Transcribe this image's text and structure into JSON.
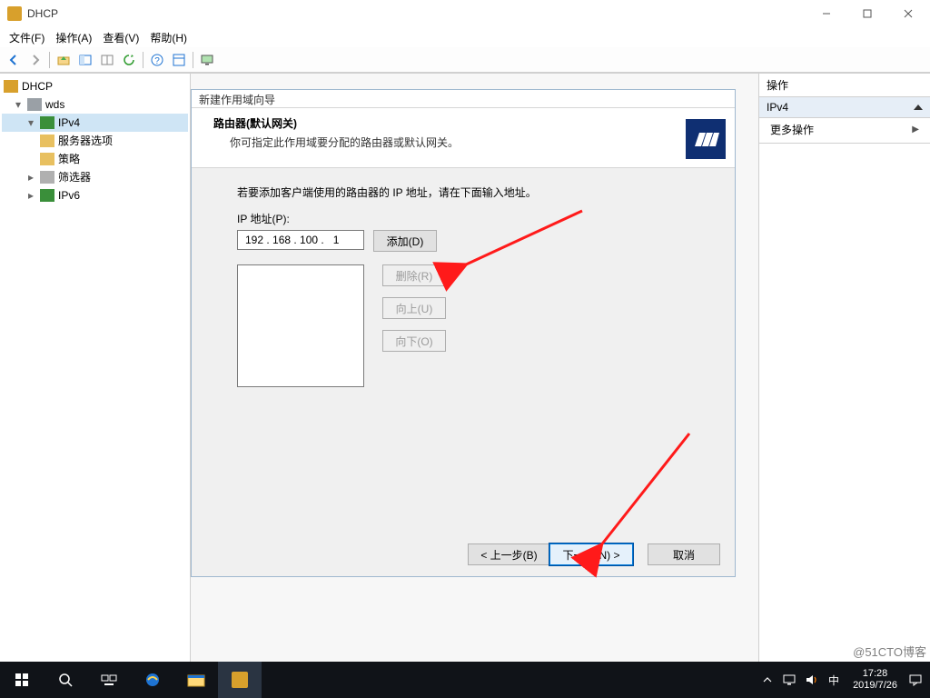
{
  "title": "DHCP",
  "menu": {
    "file": "文件(F)",
    "action": "操作(A)",
    "view": "查看(V)",
    "help": "帮助(H)"
  },
  "tree": {
    "root": "DHCP",
    "server": "wds",
    "ipv4": "IPv4",
    "server_options": "服务器选项",
    "policies": "策略",
    "filters": "筛选器",
    "ipv6": "IPv6"
  },
  "wizard": {
    "title": "新建作用域向导",
    "heading": "路由器(默认网关)",
    "subheading": "你可指定此作用域要分配的路由器或默认网关。",
    "instruction": "若要添加客户端使用的路由器的 IP 地址，请在下面输入地址。",
    "ip_label": "IP 地址(P):",
    "ip_value": "192 . 168 . 100 .   1",
    "btn_add": "添加(D)",
    "btn_remove": "删除(R)",
    "btn_up": "向上(U)",
    "btn_down": "向下(O)",
    "btn_back": "< 上一步(B)",
    "btn_next": "下一步(N) >",
    "btn_cancel": "取消"
  },
  "actions": {
    "header": "操作",
    "section": "IPv4",
    "more": "更多操作"
  },
  "taskbar": {
    "time": "17:28",
    "date": "2019/7/26",
    "ime": "中"
  },
  "watermark": "@51CTO博客"
}
